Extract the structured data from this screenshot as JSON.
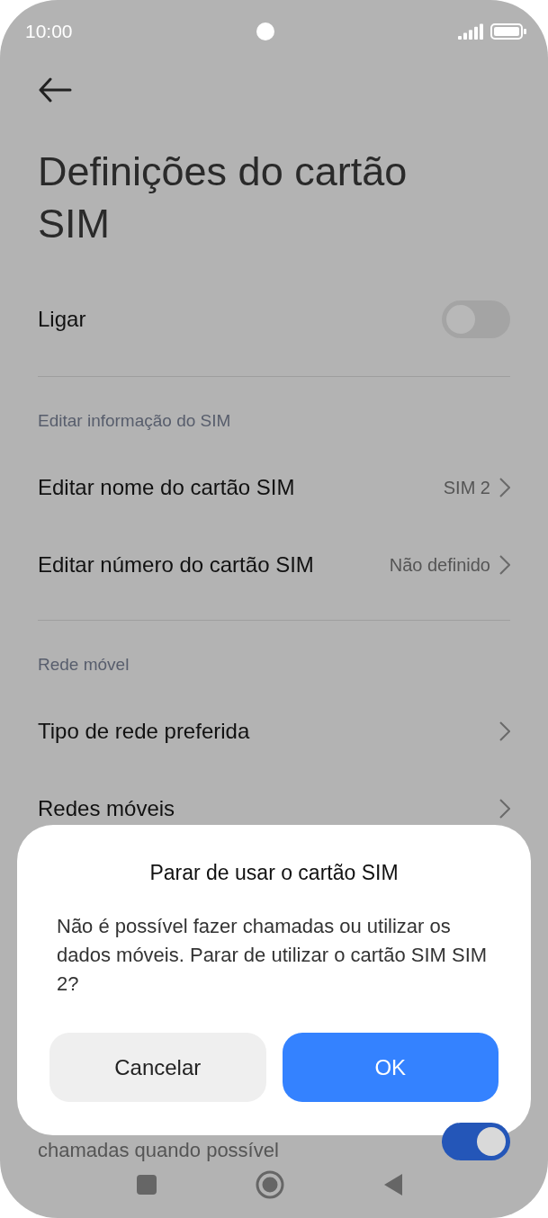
{
  "status_bar": {
    "time": "10:00"
  },
  "title": "Definições do cartão SIM",
  "sections": [
    {
      "items": [
        {
          "kind": "toggle",
          "label": "Ligar",
          "on": false
        }
      ]
    },
    {
      "header": "Editar informação do SIM",
      "items": [
        {
          "kind": "link",
          "label": "Editar nome do cartão SIM",
          "value": "SIM 2"
        },
        {
          "kind": "link",
          "label": "Editar número do cartão SIM",
          "value": "Não definido"
        }
      ]
    },
    {
      "header": "Rede móvel",
      "items": [
        {
          "kind": "link",
          "label": "Tipo de rede preferida"
        },
        {
          "kind": "link",
          "label": "Redes móveis"
        }
      ]
    }
  ],
  "bottom_row": {
    "kind": "toggle",
    "description": "chamadas quando possível",
    "on": true
  },
  "dialog": {
    "title": "Parar de usar o cartão SIM",
    "message": "Não é possível fazer chamadas ou utilizar os dados móveis. Parar de utilizar o cartão SIM SIM 2?",
    "buttons": [
      {
        "label": "Cancelar",
        "kind": "secondary"
      },
      {
        "label": "OK",
        "kind": "primary"
      }
    ]
  }
}
